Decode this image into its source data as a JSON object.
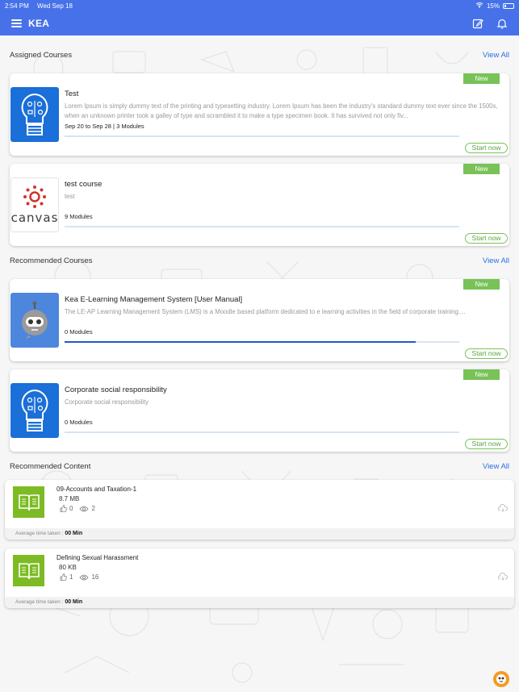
{
  "status_bar": {
    "time": "2:54 PM",
    "date": "Wed Sep 18",
    "battery": "15%"
  },
  "app": {
    "title": "KEA"
  },
  "assigned": {
    "title": "Assigned Courses",
    "view_all": "View All",
    "courses": [
      {
        "title": "Test",
        "description": "Lorem Ipsum is simply dummy text of the printing and typesetting industry. Lorem Ipsum has been the industry's standard dummy text ever since the 1500s, when an unknown printer took a galley of type and scrambled it to make a type specimen book. It has survived not only fiv...",
        "meta": "Sep 20 to Sep 28 | 3 Modules",
        "badge": "New",
        "action": "Start now",
        "progress": 0,
        "thumb": "lightbulb-icon"
      },
      {
        "title": "test course",
        "description": "test",
        "meta": "9 Modules",
        "badge": "New",
        "action": "Start now",
        "progress": 0,
        "thumb": "canvas-logo",
        "thumb_text": "canvas"
      }
    ]
  },
  "recommended": {
    "title": "Recommended Courses",
    "view_all": "View All",
    "courses": [
      {
        "title": "Kea E-Learning Management System [User Manual]",
        "description": "The LE-AP Learning Management System (LMS) is a Moodle based platform dedicated to e learning activities in the field of corporate training....",
        "meta": "0 Modules",
        "badge": "New",
        "action": "Start now",
        "progress": 0.89,
        "thumb": "robot-icon"
      },
      {
        "title": "Corporate social responsibility",
        "description": "Corporate social responsibility",
        "meta": "0 Modules",
        "badge": "New",
        "action": "Start now",
        "progress": 0,
        "thumb": "lightbulb-icon"
      }
    ]
  },
  "content": {
    "title": "Recommended Content",
    "view_all": "View All",
    "items": [
      {
        "title": "09-Accounts and Taxation-1",
        "size": "8.7 MB",
        "likes": "0",
        "views": "2",
        "avg_label": "Average time taken :",
        "avg_value": "00 Min"
      },
      {
        "title": "Defining Sexual Harassment",
        "size": "80 KB",
        "likes": "1",
        "views": "16",
        "avg_label": "Average time taken :",
        "avg_value": "00 Min"
      }
    ]
  },
  "colors": {
    "primary": "#4671e8",
    "new_badge": "#78c257",
    "link": "#2d6fdd",
    "content_thumb": "#7dbb24"
  }
}
